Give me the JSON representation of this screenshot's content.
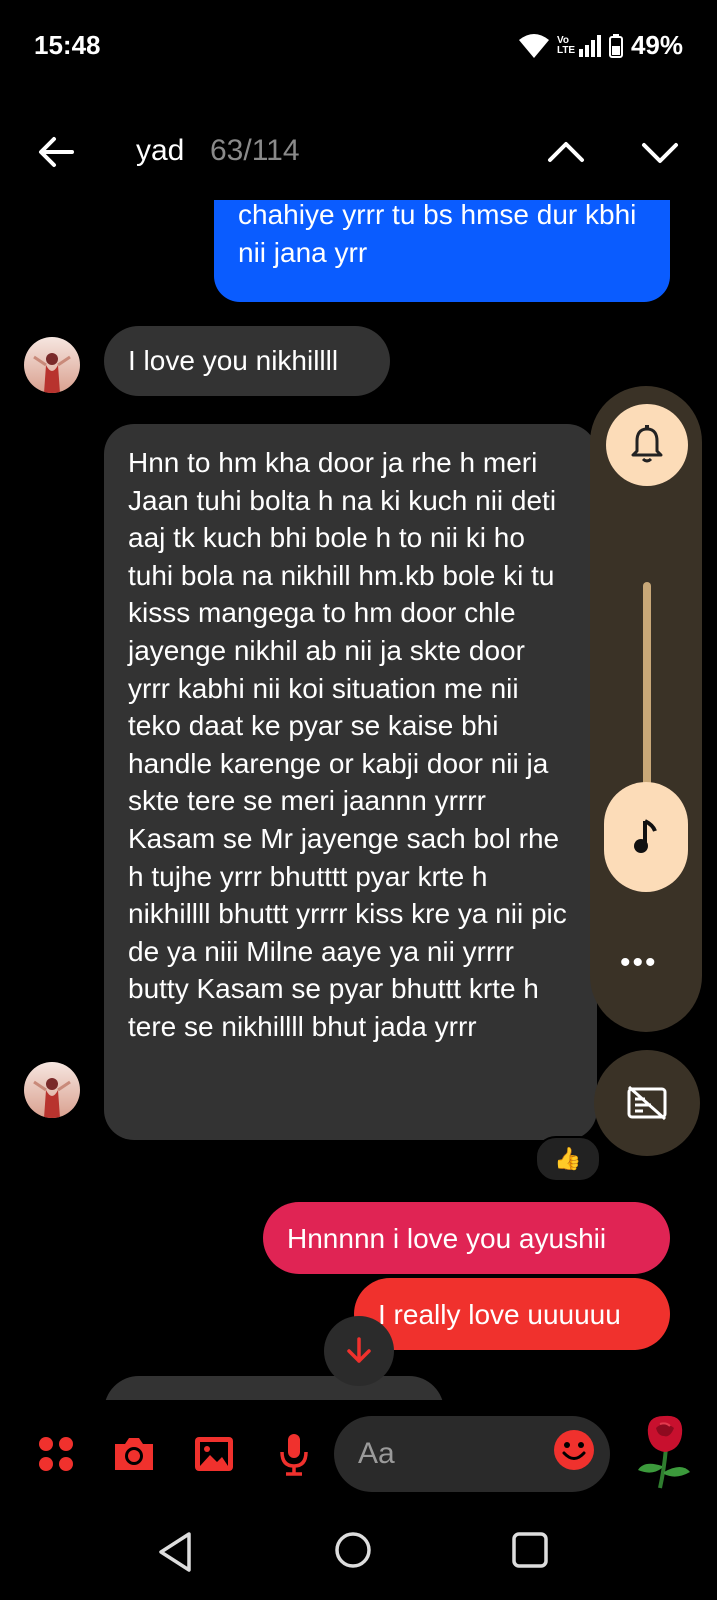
{
  "status": {
    "time": "15:48",
    "network": "Vo LTE",
    "battery": "49%"
  },
  "header": {
    "title": "yad",
    "counter": "63/114",
    "icons": {
      "back": "arrow-left-icon",
      "up": "chevron-up-icon",
      "down": "chevron-down-icon"
    }
  },
  "messages": {
    "out_blue": "chahiye yrrr tu bs hmse dur kbhi nii jana yrr",
    "in_1": "I love you nikhillll",
    "in_2": "Hnn to hm kha door ja rhe h meri Jaan tuhi bolta h na ki kuch nii deti aaj tk kuch bhi bole h to nii ki ho tuhi bola na nikhill hm.kb bole ki tu kisss mangega to hm door chle jayenge nikhil ab nii ja skte door yrrr kabhi nii koi situation me nii teko daat ke pyar se kaise bhi handle karenge or kabji door nii ja skte tere se meri jaannn yrrrr Kasam se Mr jayenge sach bol rhe h tujhe yrrr bhutttt pyar krte h nikhillll bhuttt yrrrr kiss kre ya nii pic de ya niii Milne aaye ya nii yrrrr butty Kasam se pyar bhuttt krte h tere se nikhillll bhut jada yrrr",
    "reaction": "👍",
    "out_red1": "Hnnnnn i love you ayushii",
    "out_red2": "I really love uuuuuu"
  },
  "composer": {
    "placeholder": "Aa",
    "icons": [
      "apps-icon",
      "camera-icon",
      "gallery-icon",
      "microphone-icon",
      "emoji-icon",
      "rose-icon"
    ]
  },
  "volume_panel": {
    "icons": [
      "bell-icon",
      "music-note-icon",
      "more-icon",
      "captions-off-icon"
    ]
  },
  "colors": {
    "outgoing_blue": "#0a5cff",
    "outgoing_pink": "#e02454",
    "outgoing_red": "#f0312d",
    "incoming_gray": "#333333",
    "accent_red": "#f0312d",
    "panel_bg": "#3a3226",
    "panel_accent": "#fcdcb8"
  }
}
